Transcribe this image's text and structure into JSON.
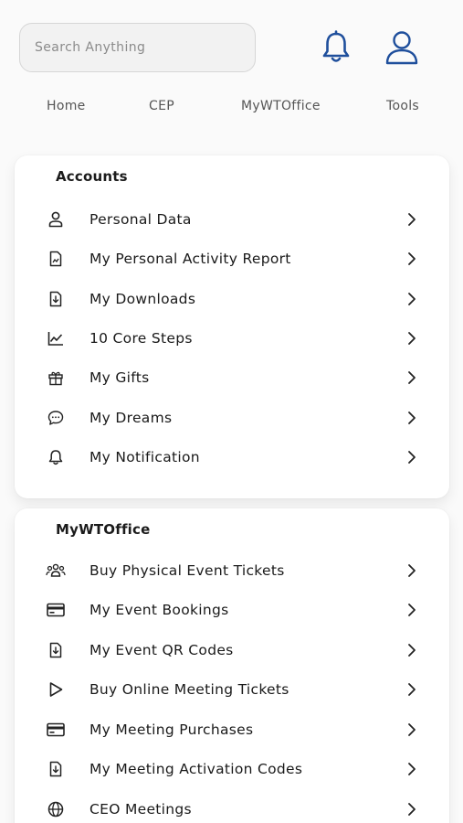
{
  "header": {
    "search_placeholder": "Search Anything",
    "bell_icon": "bell-icon",
    "user_icon": "user-icon",
    "accent_color": "#1f4f9c"
  },
  "nav": {
    "items": [
      {
        "label": "Home"
      },
      {
        "label": "CEP"
      },
      {
        "label": "MyWTOffice"
      },
      {
        "label": "Tools"
      }
    ]
  },
  "accounts": {
    "title": "Accounts",
    "items": [
      {
        "label": "Personal Data",
        "icon": "person-icon"
      },
      {
        "label": "My Personal Activity Report",
        "icon": "report-icon"
      },
      {
        "label": "My Downloads",
        "icon": "download-icon"
      },
      {
        "label": "10 Core Steps",
        "icon": "chart-icon"
      },
      {
        "label": "My Gifts",
        "icon": "gift-icon"
      },
      {
        "label": "My Dreams",
        "icon": "chat-icon"
      },
      {
        "label": "My Notification",
        "icon": "bell-icon"
      }
    ]
  },
  "mywtoffice": {
    "title": "MyWTOffice",
    "items": [
      {
        "label": "Buy Physical Event Tickets",
        "icon": "group-icon"
      },
      {
        "label": "My Event Bookings",
        "icon": "card-icon"
      },
      {
        "label": "My Event QR Codes",
        "icon": "download-icon"
      },
      {
        "label": "Buy Online Meeting Tickets",
        "icon": "play-icon"
      },
      {
        "label": "My Meeting Purchases",
        "icon": "card-icon"
      },
      {
        "label": "My Meeting Activation Codes",
        "icon": "download-icon"
      },
      {
        "label": "CEO Meetings",
        "icon": "globe-icon"
      }
    ]
  }
}
